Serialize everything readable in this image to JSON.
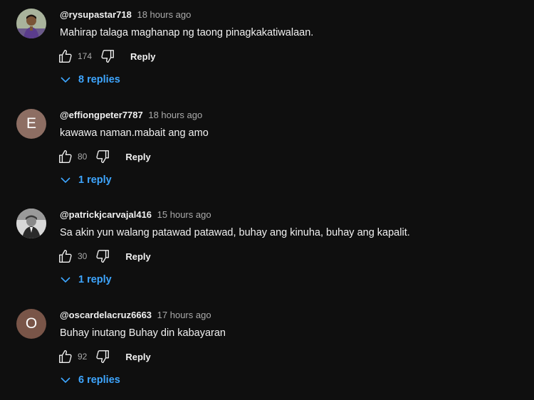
{
  "comments": [
    {
      "author": "@rysupastar718",
      "time": "18 hours ago",
      "text": "Mahirap talaga maghanap ng taong pinagkakatiwalaan.",
      "likes": "174",
      "reply_label": "Reply",
      "replies_label": "8 replies",
      "avatar": {
        "type": "photo",
        "letter": ""
      }
    },
    {
      "author": "@effiongpeter7787",
      "time": "18 hours ago",
      "text": "kawawa naman.mabait ang amo",
      "likes": "80",
      "reply_label": "Reply",
      "replies_label": "1 reply",
      "avatar": {
        "type": "letter",
        "letter": "E",
        "color": "#8d6e63"
      }
    },
    {
      "author": "@patrickjcarvajal416",
      "time": "15 hours ago",
      "text": "Sa akin yun walang patawad patawad, buhay ang kinuha, buhay ang kapalit.",
      "likes": "30",
      "reply_label": "Reply",
      "replies_label": "1 reply",
      "avatar": {
        "type": "photo",
        "letter": ""
      }
    },
    {
      "author": "@oscardelacruz6663",
      "time": "17 hours ago",
      "text": "Buhay inutang Buhay din kabayaran",
      "likes": "92",
      "reply_label": "Reply",
      "replies_label": "6 replies",
      "avatar": {
        "type": "letter",
        "letter": "O",
        "color": "#795548"
      }
    }
  ],
  "colors": {
    "background": "#0f0f0f",
    "link": "#3ea6ff",
    "secondary_text": "#aaaaaa"
  },
  "icons": {
    "like": "thumbs-up-icon",
    "dislike": "thumbs-down-icon",
    "expand": "chevron-down-icon"
  }
}
